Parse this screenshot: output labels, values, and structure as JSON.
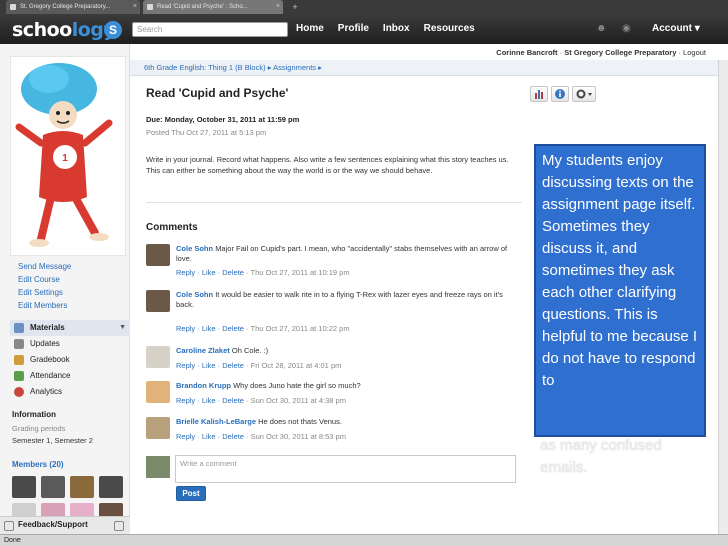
{
  "browser": {
    "tabs": [
      {
        "title": "St. Gregory College Preparatory..."
      },
      {
        "title": "Read 'Cupid and Psyche' : Scho..."
      }
    ],
    "new_tab": "+"
  },
  "topnav": {
    "logo_text_a": "schoo",
    "logo_text_b": "logy",
    "logo_badge": "S",
    "search_placeholder": "Search",
    "links": [
      "Home",
      "Profile",
      "Inbox",
      "Resources"
    ],
    "account": "Account ▾"
  },
  "userbar": {
    "user_name": "Corinne Bancroft",
    "separator": "·",
    "school": "St Gregory College Preparatory",
    "logout": "· Logout"
  },
  "sidebar": {
    "links": [
      "Send Message",
      "Edit Course",
      "Edit Settings",
      "Edit Members"
    ],
    "menu": [
      {
        "label": "Materials",
        "icon": "materials-icon",
        "color": "#6d8fc7",
        "active": true
      },
      {
        "label": "Updates",
        "icon": "updates-icon",
        "color": "#8a8a8a",
        "active": false
      },
      {
        "label": "Gradebook",
        "icon": "gradebook-icon",
        "color": "#d29b3a",
        "active": false
      },
      {
        "label": "Attendance",
        "icon": "attendance-icon",
        "color": "#5a9e4b",
        "active": false
      },
      {
        "label": "Analytics",
        "icon": "analytics-icon",
        "color": "#c9463d",
        "active": false
      }
    ],
    "information_title": "Information",
    "grading_periods_label": "Grading periods",
    "grading_periods_value": "Semester 1, Semester 2",
    "members_title": "Members (20)",
    "feedback": "Feedback/Support"
  },
  "breadcrumb": {
    "course": "6th Grade English: Thing 1 (B Block)",
    "sep": "▸",
    "section": "Assignments",
    "end": "▸"
  },
  "assignment": {
    "title": "Read 'Cupid and Psyche'",
    "due": "Due: Monday, October 31, 2011 at 11:59 pm",
    "posted": "Posted Thu Oct 27, 2011 at 5:13 pm",
    "body": "Write in your journal. Record what happens. Also write a few sentences explaining what this story teaches us. This can either be something about the way the world is or the way we should behave."
  },
  "comments_title": "Comments",
  "comments": [
    {
      "name": "Cole Sohn",
      "text": "Major Fail on Cupid's part. I mean, who \"accidentally\" stabs themselves with an arrow of love.",
      "actions": "Reply · Like · Delete",
      "date": " · Thu Oct 27, 2011 at 10:19 pm",
      "avatar_color": "#6b5a48"
    },
    {
      "name": "Cole Sohn",
      "text": "It would be easier to walk rite in to a flying T-Rex with lazer eyes and freeze rays on it's back.",
      "actions": "Reply · Like · Delete",
      "date": " · Thu Oct 27, 2011 at 10:22 pm",
      "avatar_color": "#6b5a48"
    },
    {
      "name": "Caroline Zlaket",
      "text": "Oh Cole. :)",
      "actions": "Reply · Like · Delete",
      "date": " · Fri Oct 28, 2011 at 4:01 pm",
      "avatar_color": "#d7d2c8"
    },
    {
      "name": "Brandon Krupp",
      "text": "Why does Juno hate the girl so much?",
      "actions": "Reply · Like · Delete",
      "date": " · Sun Oct 30, 2011 at 4:38 pm",
      "avatar_color": "#e0b37a"
    },
    {
      "name": "Brielle Kalish-LeBarge",
      "text": "He does not thats Venus.",
      "actions": "Reply · Like · Delete",
      "date": " · Sun Oct 30, 2011 at 8:53 pm",
      "avatar_color": "#b9a07d"
    }
  ],
  "compose": {
    "placeholder": "Write a comment",
    "post_label": "Post"
  },
  "annotation": {
    "text": "My students enjoy discussing texts on the assignment page itself.  Sometimes they discuss it, and sometimes they ask each other clarifying questions.  This is helpful to me because I do not have to respond to",
    "overflow": "as many confused emails."
  },
  "status": "Done",
  "colors": {
    "brand_blue": "#2a6ebb",
    "note_blue": "#2f6fd0",
    "nav_dark": "#2a2a2a"
  },
  "members": [
    "#4a4a4a",
    "#5a5a5a",
    "#8a6a3a",
    "#4a4a4a",
    "#cfcfcf",
    "#d9a1b8",
    "#e6b0c8",
    "#6a5040",
    "#e98ab0",
    "#e0c15a",
    "#6a8ad0",
    "#7a7a7a"
  ]
}
